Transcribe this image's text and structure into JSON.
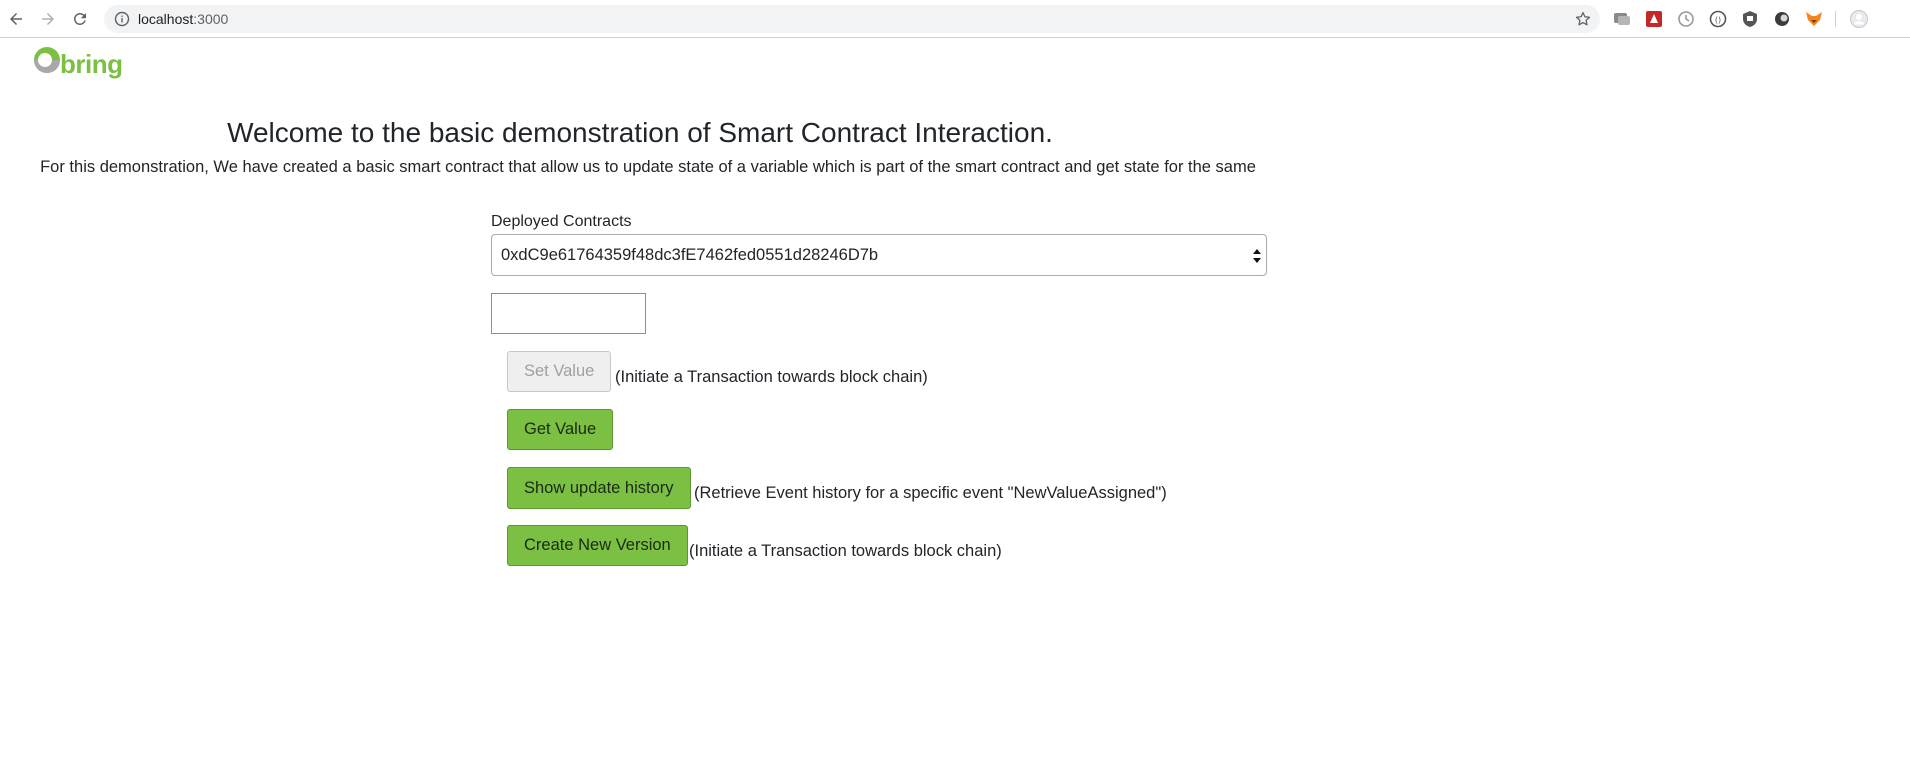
{
  "browser": {
    "url_host": "localhost",
    "url_port": ":3000",
    "back_icon": "arrow-left-icon",
    "forward_icon": "arrow-right-icon",
    "reload_icon": "reload-icon",
    "info_icon": "info-icon",
    "bookmark_icon": "star-icon",
    "extensions": [
      "chat-extension-icon",
      "red-extension-icon",
      "clock-extension-icon",
      "circle-extension-icon",
      "shield-extension-icon",
      "dark-circle-extension-icon",
      "fox-extension-icon"
    ],
    "profile_icon": "profile-icon"
  },
  "brand": {
    "logo_text": "bring",
    "color": "#7bc043"
  },
  "page": {
    "title": "Welcome to the basic demonstration of Smart Contract Interaction.",
    "subtitle": "For this demonstration, We have created a basic smart contract that allow us to update state of a variable which is part of the smart contract and get state for the same"
  },
  "contracts": {
    "label": "Deployed Contracts",
    "selected": "0xdC9e61764359f48dc3fE7462fed0551d28246D7b"
  },
  "value_input": {
    "value": "",
    "placeholder": ""
  },
  "actions": {
    "set_value": {
      "label": "Set Value",
      "hint": "(Initiate a Transaction towards block chain)",
      "disabled": true
    },
    "get_value": {
      "label": "Get Value"
    },
    "show_history": {
      "label": "Show update history",
      "hint": "(Retrieve Event history for a specific event \"NewValueAssigned\")"
    },
    "create_version": {
      "label": "Create New Version",
      "hint": "(Initiate a Transaction towards block chain)"
    }
  }
}
